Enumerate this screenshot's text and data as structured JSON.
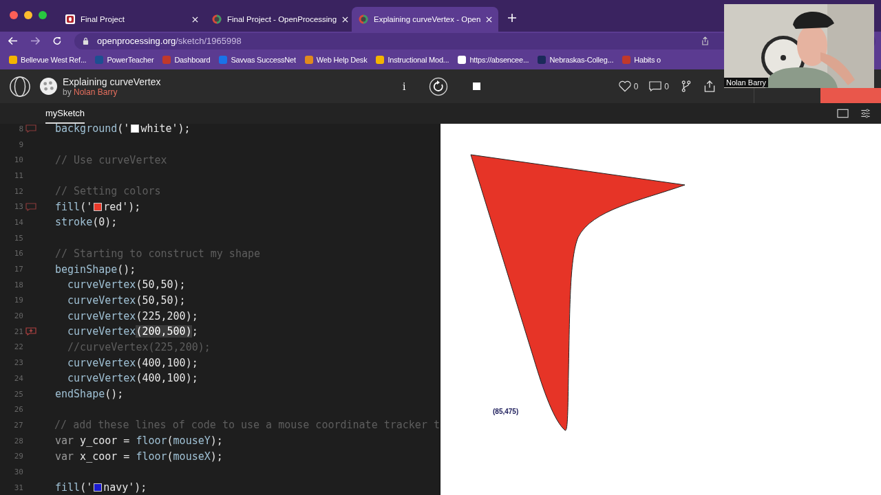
{
  "browser": {
    "tabs": [
      {
        "title": "Final Project",
        "selected": false
      },
      {
        "title": "Final Project - OpenProcessing",
        "selected": false
      },
      {
        "title": "Explaining curveVertex - Open",
        "selected": true
      }
    ],
    "address": {
      "host": "openprocessing.org",
      "path": "/sketch/1965998"
    },
    "bookmarks": [
      {
        "label": "Bellevue West Ref..."
      },
      {
        "label": "PowerTeacher"
      },
      {
        "label": "Dashboard"
      },
      {
        "label": "Savvas SuccessNet"
      },
      {
        "label": "Web Help Desk"
      },
      {
        "label": "Instructional Mod..."
      },
      {
        "label": "https://absencee..."
      },
      {
        "label": "Nebraskas-Colleg..."
      },
      {
        "label": "Habits o"
      }
    ]
  },
  "header": {
    "title": "Explaining curveVertex",
    "by": "by",
    "author": "Nolan Barry",
    "likes": "0",
    "comments": "0",
    "info": "i"
  },
  "files": [
    {
      "name": "mySketch",
      "selected": true
    }
  ],
  "code": [
    {
      "n": "8",
      "marker": {
        "kind": "comment"
      },
      "segs": [
        {
          "t": "background",
          "kind": "fn"
        },
        {
          "t": "('",
          "kind": "plain"
        },
        {
          "kind": "swatch",
          "color": "#ffffff"
        },
        {
          "t": "white');",
          "kind": "plain"
        }
      ]
    },
    {
      "n": "9"
    },
    {
      "n": "10",
      "segs": [
        {
          "t": "// Use curveVertex",
          "kind": "comment"
        }
      ]
    },
    {
      "n": "11"
    },
    {
      "n": "12",
      "segs": [
        {
          "t": "// Setting colors",
          "kind": "comment"
        }
      ]
    },
    {
      "n": "13",
      "marker": {
        "kind": "comment"
      },
      "segs": [
        {
          "t": "fill",
          "kind": "fn"
        },
        {
          "t": "('",
          "kind": "plain"
        },
        {
          "kind": "swatch",
          "color": "#e8392a"
        },
        {
          "t": "red');",
          "kind": "plain"
        }
      ]
    },
    {
      "n": "14",
      "segs": [
        {
          "t": "stroke",
          "kind": "fn"
        },
        {
          "t": "(0);",
          "kind": "plain"
        }
      ]
    },
    {
      "n": "15"
    },
    {
      "n": "16",
      "segs": [
        {
          "t": "// Starting to construct my shape",
          "kind": "comment"
        }
      ]
    },
    {
      "n": "17",
      "segs": [
        {
          "t": "beginShape",
          "kind": "fn"
        },
        {
          "t": "();",
          "kind": "plain"
        }
      ]
    },
    {
      "n": "18",
      "segs": [
        {
          "t": "  curveVertex",
          "kind": "fn"
        },
        {
          "t": "(50,50);",
          "kind": "plain"
        }
      ]
    },
    {
      "n": "19",
      "segs": [
        {
          "t": "  curveVertex",
          "kind": "fn"
        },
        {
          "t": "(50,50);",
          "kind": "plain"
        }
      ]
    },
    {
      "n": "20",
      "segs": [
        {
          "t": "  curveVertex",
          "kind": "fn"
        },
        {
          "t": "(225,200);",
          "kind": "plain"
        }
      ]
    },
    {
      "n": "21",
      "marker": {
        "kind": "add"
      },
      "segs": [
        {
          "t": "  curveVertex",
          "kind": "fn"
        },
        {
          "t": "(200,500)",
          "kind": "sel"
        },
        {
          "t": ";",
          "kind": "plain"
        }
      ]
    },
    {
      "n": "22",
      "segs": [
        {
          "t": "  //curveVertex(225,200);",
          "kind": "comment"
        }
      ]
    },
    {
      "n": "23",
      "segs": [
        {
          "t": "  curveVertex",
          "kind": "fn"
        },
        {
          "t": "(400,100);",
          "kind": "plain"
        }
      ]
    },
    {
      "n": "24",
      "segs": [
        {
          "t": "  curveVertex",
          "kind": "fn"
        },
        {
          "t": "(400,100);",
          "kind": "plain"
        }
      ]
    },
    {
      "n": "25",
      "segs": [
        {
          "t": "endShape",
          "kind": "fn"
        },
        {
          "t": "();",
          "kind": "plain"
        }
      ]
    },
    {
      "n": "26"
    },
    {
      "n": "27",
      "segs": [
        {
          "t": "// add these lines of code to use a mouse coordinate tracker t",
          "kind": "comment"
        }
      ]
    },
    {
      "n": "28",
      "segs": [
        {
          "t": "var",
          "kind": "kw"
        },
        {
          "t": " y_coor = ",
          "kind": "plain"
        },
        {
          "t": "floor",
          "kind": "fn"
        },
        {
          "t": "(",
          "kind": "plain"
        },
        {
          "t": "mouseY",
          "kind": "fn"
        },
        {
          "t": ");",
          "kind": "plain"
        }
      ]
    },
    {
      "n": "29",
      "segs": [
        {
          "t": "var",
          "kind": "kw"
        },
        {
          "t": " x_coor = ",
          "kind": "plain"
        },
        {
          "t": "floor",
          "kind": "fn"
        },
        {
          "t": "(",
          "kind": "plain"
        },
        {
          "t": "mouseX",
          "kind": "fn"
        },
        {
          "t": ");",
          "kind": "plain"
        }
      ]
    },
    {
      "n": "30"
    },
    {
      "n": "31",
      "segs": [
        {
          "t": "fill",
          "kind": "fn"
        },
        {
          "t": "('",
          "kind": "plain"
        },
        {
          "kind": "swatch",
          "color": "#1a1ad0"
        },
        {
          "t": "navy');",
          "kind": "plain"
        }
      ]
    }
  ],
  "canvas": {
    "coordinate": "(85,475)"
  },
  "webcam": {
    "name": "Nolan Barry"
  }
}
